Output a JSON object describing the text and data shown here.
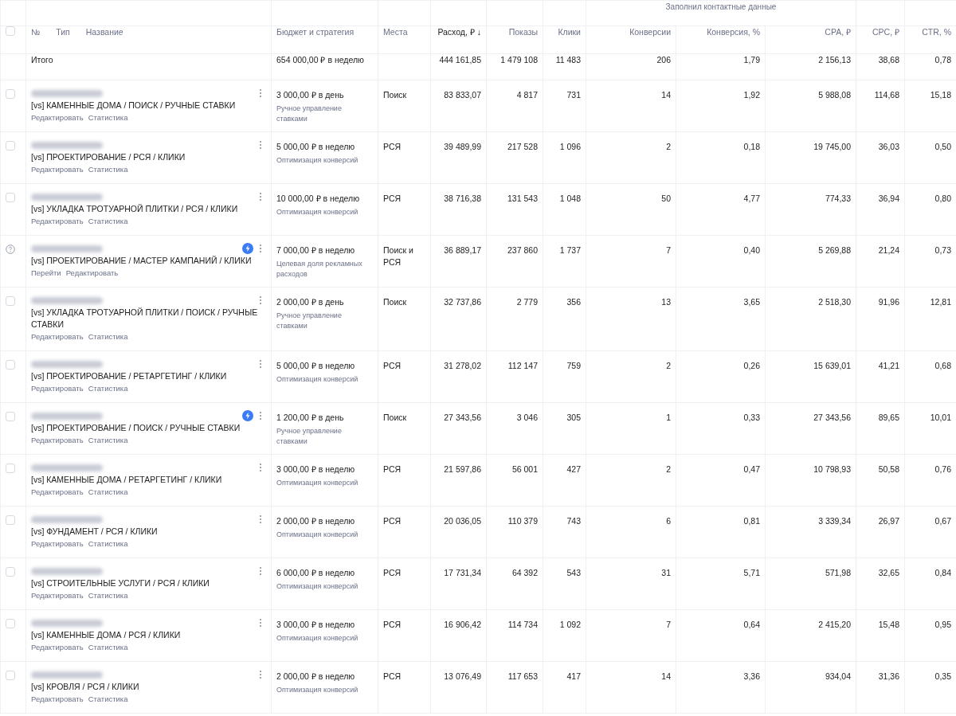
{
  "group_header": "Заполнил контактные данные",
  "select_all": {
    "checked": false
  },
  "columns": [
    {
      "label": "№",
      "sorted": false
    },
    {
      "label": "Тип",
      "sorted": false
    },
    {
      "label": "Название",
      "sorted": false
    },
    {
      "label": "Бюджет и стратегия",
      "sorted": false
    },
    {
      "label": "Места",
      "sorted": false
    },
    {
      "label": "Расход, ₽ ↓",
      "sorted": true
    },
    {
      "label": "Показы",
      "sorted": false
    },
    {
      "label": "Клики",
      "sorted": false
    },
    {
      "label": "Конверсии",
      "sorted": false
    },
    {
      "label": "Конверсия, %",
      "sorted": false
    },
    {
      "label": "CPA, ₽",
      "sorted": false
    },
    {
      "label": "CPC, ₽",
      "sorted": false
    },
    {
      "label": "CTR, %",
      "sorted": false
    }
  ],
  "total": {
    "label": "Итого",
    "budget": "654 000,00 ₽ в неделю",
    "values": [
      "444 161,85",
      "1 479 108",
      "11 483",
      "206",
      "1,79",
      "2 156,13",
      "38,68",
      "0,78"
    ]
  },
  "rows": [
    {
      "kind": "checkbox",
      "checked": false,
      "fast": false,
      "name": "[vs] КАМЕННЫЕ ДОМА / ПОИСК / РУЧНЫЕ СТАВКИ",
      "links": [
        "Редактировать",
        "Статистика"
      ],
      "budget": "3 000,00 ₽ в день",
      "strategy": "Ручное управление ставками",
      "places": "Поиск",
      "values": [
        "83 833,07",
        "4 817",
        "731",
        "14",
        "1,92",
        "5 988,08",
        "114,68",
        "15,18"
      ]
    },
    {
      "kind": "checkbox",
      "checked": false,
      "fast": false,
      "name": "[vs] ПРОЕКТИРОВАНИЕ / РСЯ / КЛИКИ",
      "links": [
        "Редактировать",
        "Статистика"
      ],
      "budget": "5 000,00 ₽ в неделю",
      "strategy": "Оптимизация конверсий",
      "places": "РСЯ",
      "values": [
        "39 489,99",
        "217 528",
        "1 096",
        "2",
        "0,18",
        "19 745,00",
        "36,03",
        "0,50"
      ]
    },
    {
      "kind": "checkbox",
      "checked": false,
      "fast": false,
      "name": "[vs] УКЛАДКА ТРОТУАРНОЙ ПЛИТКИ / РСЯ / КЛИКИ",
      "links": [
        "Редактировать",
        "Статистика"
      ],
      "budget": "10 000,00 ₽ в неделю",
      "strategy": "Оптимизация конверсий",
      "places": "РСЯ",
      "values": [
        "38 716,38",
        "131 543",
        "1 048",
        "50",
        "4,77",
        "774,33",
        "36,94",
        "0,80"
      ]
    },
    {
      "kind": "help",
      "fast": true,
      "name": "[vs] ПРОЕКТИРОВАНИЕ / МАСТЕР КАМПАНИЙ / КЛИКИ",
      "links": [
        "Перейти",
        "Редактировать"
      ],
      "budget": "7 000,00 ₽ в неделю",
      "strategy": "Целевая доля рекламных расходов",
      "places": "Поиск и РСЯ",
      "values": [
        "36 889,17",
        "237 860",
        "1 737",
        "7",
        "0,40",
        "5 269,88",
        "21,24",
        "0,73"
      ]
    },
    {
      "kind": "checkbox",
      "checked": false,
      "fast": false,
      "name": "[vs] УКЛАДКА ТРОТУАРНОЙ ПЛИТКИ / ПОИСК / РУЧНЫЕ СТАВКИ",
      "links": [
        "Редактировать",
        "Статистика"
      ],
      "budget": "2 000,00 ₽ в день",
      "strategy": "Ручное управление ставками",
      "places": "Поиск",
      "values": [
        "32 737,86",
        "2 779",
        "356",
        "13",
        "3,65",
        "2 518,30",
        "91,96",
        "12,81"
      ]
    },
    {
      "kind": "checkbox",
      "checked": false,
      "fast": false,
      "name": "[vs] ПРОЕКТИРОВАНИЕ / РЕТАРГЕТИНГ / КЛИКИ",
      "links": [
        "Редактировать",
        "Статистика"
      ],
      "budget": "5 000,00 ₽ в неделю",
      "strategy": "Оптимизация конверсий",
      "places": "РСЯ",
      "values": [
        "31 278,02",
        "112 147",
        "759",
        "2",
        "0,26",
        "15 639,01",
        "41,21",
        "0,68"
      ]
    },
    {
      "kind": "checkbox",
      "checked": false,
      "fast": true,
      "name": "[vs] ПРОЕКТИРОВАНИЕ / ПОИСК / РУЧНЫЕ СТАВКИ",
      "links": [
        "Редактировать",
        "Статистика"
      ],
      "budget": "1 200,00 ₽ в день",
      "strategy": "Ручное управление ставками",
      "places": "Поиск",
      "values": [
        "27 343,56",
        "3 046",
        "305",
        "1",
        "0,33",
        "27 343,56",
        "89,65",
        "10,01"
      ]
    },
    {
      "kind": "checkbox",
      "checked": false,
      "fast": false,
      "name": "[vs] КАМЕННЫЕ ДОМА / РЕТАРГЕТИНГ / КЛИКИ",
      "links": [
        "Редактировать",
        "Статистика"
      ],
      "budget": "3 000,00 ₽ в неделю",
      "strategy": "Оптимизация конверсий",
      "places": "РСЯ",
      "values": [
        "21 597,86",
        "56 001",
        "427",
        "2",
        "0,47",
        "10 798,93",
        "50,58",
        "0,76"
      ]
    },
    {
      "kind": "checkbox",
      "checked": false,
      "fast": false,
      "name": "[vs] ФУНДАМЕНТ / РСЯ / КЛИКИ",
      "links": [
        "Редактировать",
        "Статистика"
      ],
      "budget": "2 000,00 ₽ в неделю",
      "strategy": "Оптимизация конверсий",
      "places": "РСЯ",
      "values": [
        "20 036,05",
        "110 379",
        "743",
        "6",
        "0,81",
        "3 339,34",
        "26,97",
        "0,67"
      ]
    },
    {
      "kind": "checkbox",
      "checked": false,
      "fast": false,
      "name": "[vs] СТРОИТЕЛЬНЫЕ УСЛУГИ / РСЯ / КЛИКИ",
      "links": [
        "Редактировать",
        "Статистика"
      ],
      "budget": "6 000,00 ₽ в неделю",
      "strategy": "Оптимизация конверсий",
      "places": "РСЯ",
      "values": [
        "17 731,34",
        "64 392",
        "543",
        "31",
        "5,71",
        "571,98",
        "32,65",
        "0,84"
      ]
    },
    {
      "kind": "checkbox",
      "checked": false,
      "fast": false,
      "name": "[vs] КАМЕННЫЕ ДОМА / РСЯ / КЛИКИ",
      "links": [
        "Редактировать",
        "Статистика"
      ],
      "budget": "3 000,00 ₽ в неделю",
      "strategy": "Оптимизация конверсий",
      "places": "РСЯ",
      "values": [
        "16 906,42",
        "114 734",
        "1 092",
        "7",
        "0,64",
        "2 415,20",
        "15,48",
        "0,95"
      ]
    },
    {
      "kind": "checkbox",
      "checked": false,
      "fast": false,
      "name": "[vs] КРОВЛЯ / РСЯ / КЛИКИ",
      "links": [
        "Редактировать",
        "Статистика"
      ],
      "budget": "2 000,00 ₽ в неделю",
      "strategy": "Оптимизация конверсий",
      "places": "РСЯ",
      "values": [
        "13 076,49",
        "117 653",
        "417",
        "14",
        "3,36",
        "934,04",
        "31,36",
        "0,35"
      ]
    }
  ]
}
